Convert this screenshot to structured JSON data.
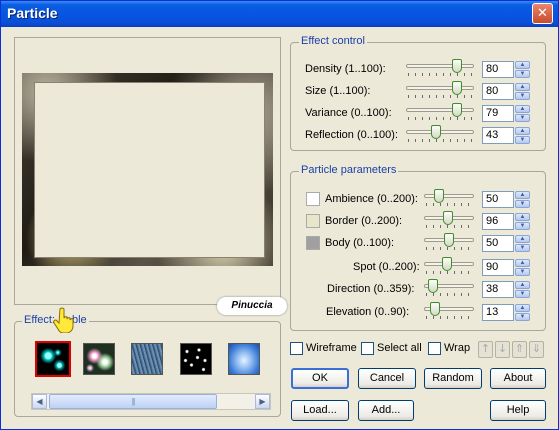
{
  "window": {
    "title": "Particle",
    "close_glyph": "✕"
  },
  "watermark": "Pinuccia",
  "effect_control": {
    "legend": "Effect control",
    "rows": [
      {
        "label": "Density (1..100):",
        "value": "80",
        "level": 80
      },
      {
        "label": "Size (1..100):",
        "value": "80",
        "level": 80
      },
      {
        "label": "Variance (0..100):",
        "value": "79",
        "level": 79
      },
      {
        "label": "Reflection (0..100):",
        "value": "43",
        "level": 43
      }
    ]
  },
  "particle_parameters": {
    "legend": "Particle parameters",
    "rows": [
      {
        "label": "Ambience (0..200):",
        "value": "50",
        "level": 25,
        "swatch": "#ffffff"
      },
      {
        "label": "Border (0..200):",
        "value": "96",
        "level": 48,
        "swatch": "#e8e6c8"
      },
      {
        "label": "Body (0..100):",
        "value": "50",
        "level": 50,
        "swatch": "#a0a0a0"
      },
      {
        "label": "Spot (0..200):",
        "value": "90",
        "level": 45
      },
      {
        "label": "Direction (0..359):",
        "value": "38",
        "level": 11
      },
      {
        "label": "Elevation (0..90):",
        "value": "13",
        "level": 14
      }
    ]
  },
  "effect_group": {
    "legend_prefix": "Effect:",
    "legend_suffix": "ble",
    "thumbs": [
      {
        "name": "bubble-effect-thumb",
        "selected": true
      },
      {
        "name": "glow-effect-thumb",
        "selected": false
      },
      {
        "name": "rain-effect-thumb",
        "selected": false
      },
      {
        "name": "stars-effect-thumb",
        "selected": false
      },
      {
        "name": "sky-effect-thumb",
        "selected": false
      }
    ],
    "scroll_left": "◀",
    "scroll_right": "▶",
    "scroll_grip": "|||"
  },
  "options": {
    "wireframe": "Wireframe",
    "select_all": "Select all",
    "wrap": "Wrap"
  },
  "arrows": [
    "↑",
    "↓",
    "⇑",
    "⇓"
  ],
  "buttons": {
    "ok": "OK",
    "cancel": "Cancel",
    "random": "Random",
    "about": "About",
    "load": "Load...",
    "add": "Add...",
    "help": "Help"
  },
  "spin": {
    "up": "▲",
    "down": "▼"
  },
  "cursor_icon": "hand-pointer-icon"
}
